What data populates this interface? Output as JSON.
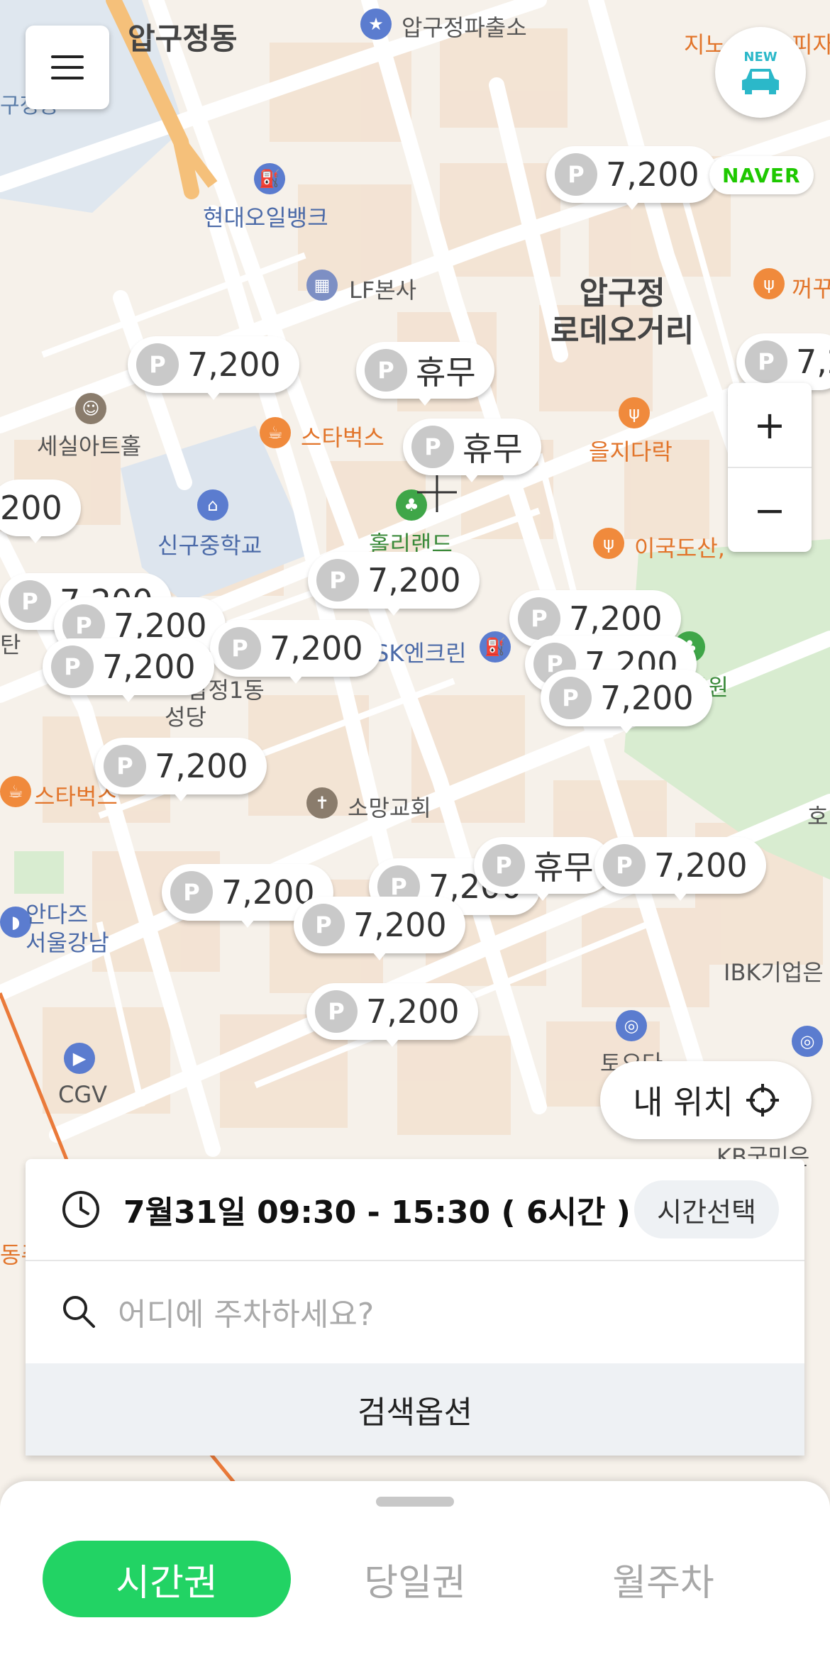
{
  "map": {
    "labels": {
      "apgujeong_dong": "압구정동",
      "apgujeong_police": "압구정파출소",
      "hyundai_oil_bank": "현대오일뱅크",
      "lf_hq": "LF본사",
      "apgujeong_rodeo": "압구정\n로데오거리",
      "sejil_art_hall": "세실아트홀",
      "starbucks_1": "스타벅스",
      "euljidarak": "을지다락",
      "singu_middle_school": "신구중학교",
      "hollyland": "홀리랜드",
      "idosan": "이국도산,",
      "park": "공원",
      "sk_encleen": "SK엔크린",
      "cathedral_1": "압정1동",
      "cathedral_2": "성당",
      "starbucks_2": "스타벅스",
      "somang_church": "소망교회",
      "adidas_1": "안다즈",
      "adidas_2": "서울강남",
      "cgv": "CGV",
      "ibk": "IBK기업은",
      "to_o_da": "토오다",
      "kb": "KB국민은",
      "jino": "지노",
      "pizza": "피자",
      "kkakku": "꺼꾸",
      "gujeong": "구정동",
      "tan": "탄",
      "ho": "호",
      "dongsu": "동주"
    },
    "pins": [
      {
        "text": "7,200"
      },
      {
        "text": "7,200"
      },
      {
        "text": "휴무"
      },
      {
        "text": "휴무"
      },
      {
        "text": "7,2"
      },
      {
        "text": "200"
      },
      {
        "text": "7,200"
      },
      {
        "text": "7,200"
      },
      {
        "text": "7,200"
      },
      {
        "text": "7,200"
      },
      {
        "text": "7,200"
      },
      {
        "text": "7,200"
      },
      {
        "text": "7,200"
      },
      {
        "text": "7,200"
      },
      {
        "text": "7,200"
      },
      {
        "text": "7,200"
      },
      {
        "text": "휴무"
      },
      {
        "text": "7,200"
      },
      {
        "text": "7,200"
      },
      {
        "text": "7,200"
      }
    ],
    "pin_icon_letter": "P",
    "naver_logo": "NAVER",
    "new_badge": "NEW"
  },
  "controls": {
    "zoom_in": "+",
    "zoom_out": "−",
    "my_location": "내 위치"
  },
  "panel": {
    "time_text": "7월31일 09:30 - 15:30 ( 6시간 )",
    "time_select": "시간선택",
    "search_placeholder": "어디에 주차하세요?",
    "search_options": "검색옵션"
  },
  "tabs": [
    {
      "label": "시간권",
      "active": true
    },
    {
      "label": "당일권",
      "active": false
    },
    {
      "label": "월주차",
      "active": false
    }
  ],
  "colors": {
    "accent_green": "#22d364",
    "naver_green": "#1ec800",
    "poi_blue": "#5b7ccf",
    "poi_orange": "#f08a3c"
  }
}
